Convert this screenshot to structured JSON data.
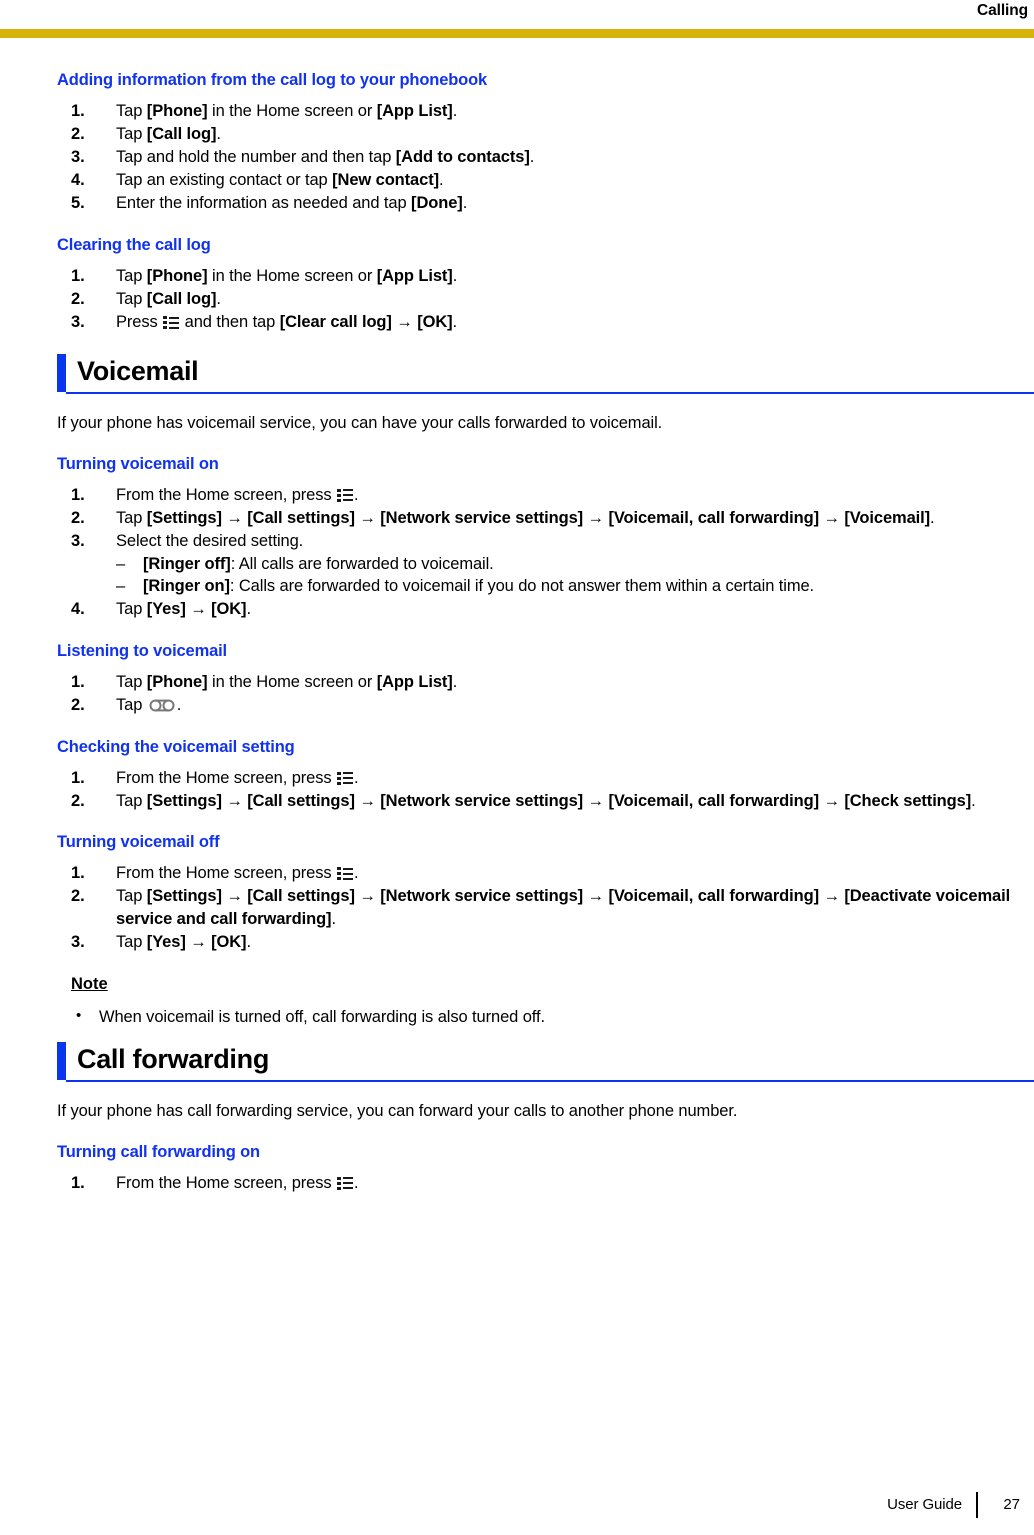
{
  "header": {
    "running_title": "Calling",
    "rule_color": "#D7B20B"
  },
  "colors": {
    "heading_blue": "#1133EE",
    "section_blue": "#0A35EE",
    "gold": "#D7B20B"
  },
  "icons": {
    "menu": "menu-list-icon",
    "voicemail": "voicemail-tape-icon"
  },
  "sections": [
    {
      "id": "adding-information",
      "heading": "Adding information from the call log to your phonebook",
      "steps": [
        {
          "parts": [
            {
              "t": "Tap "
            },
            {
              "b": "[Phone]"
            },
            {
              "t": " in the Home screen or "
            },
            {
              "b": "[App List]"
            },
            {
              "t": "."
            }
          ]
        },
        {
          "parts": [
            {
              "t": "Tap "
            },
            {
              "b": "[Call log]"
            },
            {
              "t": "."
            }
          ]
        },
        {
          "parts": [
            {
              "t": "Tap and hold the number and then tap "
            },
            {
              "b": "[Add to contacts]"
            },
            {
              "t": "."
            }
          ]
        },
        {
          "parts": [
            {
              "t": "Tap an existing contact or tap "
            },
            {
              "b": "[New contact]"
            },
            {
              "t": "."
            }
          ]
        },
        {
          "parts": [
            {
              "t": "Enter the information as needed and tap "
            },
            {
              "b": "[Done]"
            },
            {
              "t": "."
            }
          ]
        }
      ]
    },
    {
      "id": "clearing-the-call-log",
      "heading": "Clearing the call log",
      "steps": [
        {
          "parts": [
            {
              "t": "Tap "
            },
            {
              "b": "[Phone]"
            },
            {
              "t": " in the Home screen or "
            },
            {
              "b": "[App List]"
            },
            {
              "t": "."
            }
          ]
        },
        {
          "parts": [
            {
              "t": "Tap "
            },
            {
              "b": "[Call log]"
            },
            {
              "t": "."
            }
          ]
        },
        {
          "parts": [
            {
              "t": "Press "
            },
            {
              "icon": "menu"
            },
            {
              "t": " and then tap "
            },
            {
              "b": "[Clear call log]"
            },
            {
              "t": " "
            },
            {
              "a": "→"
            },
            {
              "t": " "
            },
            {
              "b": "[OK]"
            },
            {
              "t": "."
            }
          ]
        }
      ]
    }
  ],
  "voicemail": {
    "title": "Voicemail",
    "intro": "If your phone has voicemail service, you can have your calls forwarded to voicemail.",
    "subsections": [
      {
        "id": "turning-voicemail-on",
        "heading": "Turning voicemail on",
        "steps": [
          {
            "parts": [
              {
                "t": "From the Home screen, press "
              },
              {
                "icon": "menu"
              },
              {
                "t": "."
              }
            ]
          },
          {
            "parts": [
              {
                "t": "Tap "
              },
              {
                "b": "[Settings]"
              },
              {
                "t": " "
              },
              {
                "a": "→"
              },
              {
                "t": " "
              },
              {
                "b": "[Call settings]"
              },
              {
                "t": " "
              },
              {
                "a": "→"
              },
              {
                "t": " "
              },
              {
                "b": "[Network service settings]"
              },
              {
                "t": " "
              },
              {
                "a": "→"
              },
              {
                "t": " "
              },
              {
                "b": "[Voicemail, call forwarding]"
              },
              {
                "t": " "
              },
              {
                "a": "→"
              },
              {
                "t": " "
              },
              {
                "b": "[Voicemail]"
              },
              {
                "t": "."
              }
            ]
          },
          {
            "parts": [
              {
                "t": "Select the desired setting."
              }
            ],
            "sub": [
              {
                "parts": [
                  {
                    "b": "[Ringer off]"
                  },
                  {
                    "t": ": All calls are forwarded to voicemail."
                  }
                ]
              },
              {
                "parts": [
                  {
                    "b": "[Ringer on]"
                  },
                  {
                    "t": ": Calls are forwarded to voicemail if you do not answer them within a certain time."
                  }
                ]
              }
            ]
          },
          {
            "parts": [
              {
                "t": "Tap "
              },
              {
                "b": "[Yes]"
              },
              {
                "t": " "
              },
              {
                "a": "→"
              },
              {
                "t": " "
              },
              {
                "b": "[OK]"
              },
              {
                "t": "."
              }
            ]
          }
        ]
      },
      {
        "id": "listening-to-voicemail",
        "heading": "Listening to voicemail",
        "steps": [
          {
            "parts": [
              {
                "t": "Tap "
              },
              {
                "b": "[Phone]"
              },
              {
                "t": " in the Home screen or "
              },
              {
                "b": "[App List]"
              },
              {
                "t": "."
              }
            ]
          },
          {
            "parts": [
              {
                "t": "Tap "
              },
              {
                "icon": "voicemail"
              },
              {
                "t": "."
              }
            ]
          }
        ]
      },
      {
        "id": "checking-the-voicemail-setting",
        "heading": "Checking the voicemail setting",
        "steps": [
          {
            "parts": [
              {
                "t": "From the Home screen, press "
              },
              {
                "icon": "menu"
              },
              {
                "t": "."
              }
            ]
          },
          {
            "parts": [
              {
                "t": "Tap "
              },
              {
                "b": "[Settings]"
              },
              {
                "t": " "
              },
              {
                "a": "→"
              },
              {
                "t": " "
              },
              {
                "b": "[Call settings]"
              },
              {
                "t": " "
              },
              {
                "a": "→"
              },
              {
                "t": " "
              },
              {
                "b": "[Network service settings]"
              },
              {
                "t": " "
              },
              {
                "a": "→"
              },
              {
                "t": " "
              },
              {
                "b": "[Voicemail, call forwarding]"
              },
              {
                "t": " "
              },
              {
                "a": "→"
              },
              {
                "t": " "
              },
              {
                "b": "[Check settings]"
              },
              {
                "t": "."
              }
            ]
          }
        ]
      },
      {
        "id": "turning-voicemail-off",
        "heading": "Turning voicemail off",
        "steps": [
          {
            "parts": [
              {
                "t": "From the Home screen, press "
              },
              {
                "icon": "menu"
              },
              {
                "t": "."
              }
            ]
          },
          {
            "parts": [
              {
                "t": "Tap "
              },
              {
                "b": "[Settings]"
              },
              {
                "t": " "
              },
              {
                "a": "→"
              },
              {
                "t": " "
              },
              {
                "b": "[Call settings]"
              },
              {
                "t": " "
              },
              {
                "a": "→"
              },
              {
                "t": " "
              },
              {
                "b": "[Network service settings]"
              },
              {
                "t": " "
              },
              {
                "a": "→"
              },
              {
                "t": " "
              },
              {
                "b": "[Voicemail, call forwarding]"
              },
              {
                "t": " "
              },
              {
                "a": "→"
              },
              {
                "t": " "
              },
              {
                "b": "[Deactivate voicemail service and call forwarding]"
              },
              {
                "t": "."
              }
            ]
          },
          {
            "parts": [
              {
                "t": "Tap "
              },
              {
                "b": "[Yes]"
              },
              {
                "t": " "
              },
              {
                "a": "→"
              },
              {
                "t": " "
              },
              {
                "b": "[OK]"
              },
              {
                "t": "."
              }
            ]
          }
        ]
      }
    ],
    "note": {
      "title": "Note",
      "items": [
        "When voicemail is turned off, call forwarding is also turned off."
      ]
    }
  },
  "call_forwarding": {
    "title": "Call forwarding",
    "intro": "If your phone has call forwarding service, you can forward your calls to another phone number.",
    "subsections": [
      {
        "id": "turning-call-forwarding-on",
        "heading": "Turning call forwarding on",
        "steps": [
          {
            "parts": [
              {
                "t": "From the Home screen, press "
              },
              {
                "icon": "menu"
              },
              {
                "t": "."
              }
            ]
          }
        ]
      }
    ]
  },
  "footer": {
    "guide_label": "User Guide",
    "page_number": "27"
  }
}
